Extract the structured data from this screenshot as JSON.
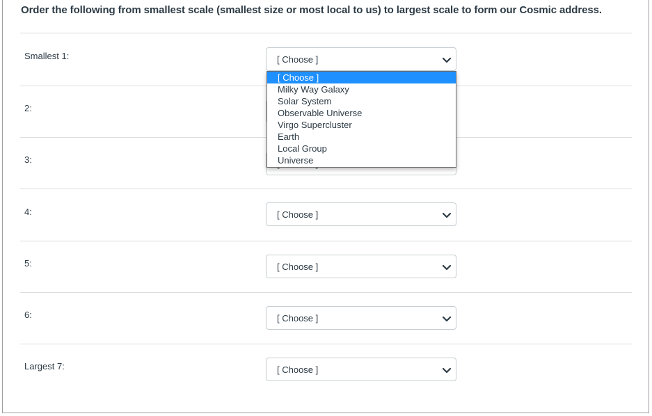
{
  "question": {
    "text": "Order the following from smallest scale (smallest size or most local to us) to largest scale to form our Cosmic address."
  },
  "rows": [
    {
      "label": "Smallest 1:",
      "selected": "[ Choose ]"
    },
    {
      "label": "2:",
      "selected": "[ Choose ]"
    },
    {
      "label": "3:",
      "selected": "[ Choose ]"
    },
    {
      "label": "4:",
      "selected": "[ Choose ]"
    },
    {
      "label": "5:",
      "selected": "[ Choose ]"
    },
    {
      "label": "6:",
      "selected": "[ Choose ]"
    },
    {
      "label": "Largest 7:",
      "selected": "[ Choose ]"
    }
  ],
  "dropdown": {
    "open_for_row": "Smallest 1:",
    "highlighted": "[ Choose ]",
    "options": [
      "[ Choose ]",
      "Milky Way Galaxy",
      "Solar System",
      "Observable Universe",
      "Virgo Supercluster",
      "Earth",
      "Local Group",
      "Universe"
    ]
  },
  "colors": {
    "highlight": "#1e90ff",
    "text": "#2d3b45",
    "divider": "#dcdcdc"
  }
}
